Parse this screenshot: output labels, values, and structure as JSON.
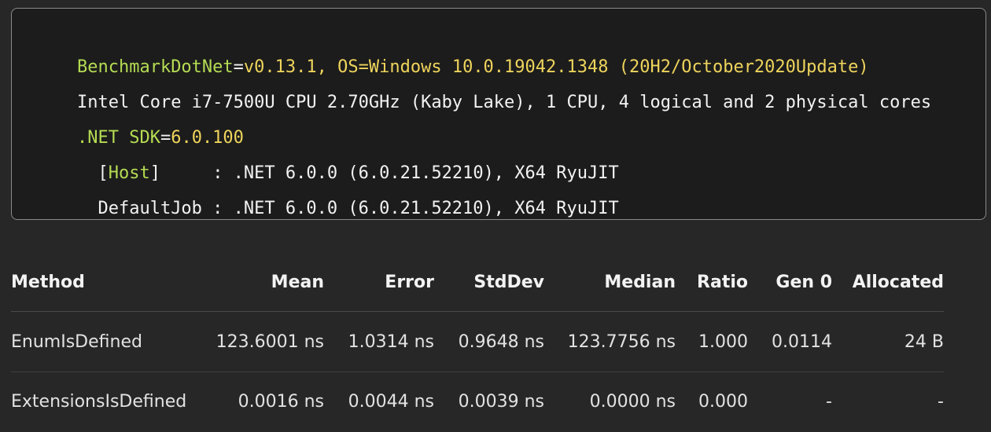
{
  "code_block": {
    "lines": [
      {
        "parts": [
          {
            "text": "BenchmarkDotNet",
            "color": "#b5dc53"
          },
          {
            "text": "=",
            "color": "#f2f2f2"
          },
          {
            "text": "v0.13.1, OS=Windows 10.0.19042.1348 (20H2/October2020Update)",
            "color": "#eed45c"
          }
        ]
      },
      {
        "parts": [
          {
            "text": "Intel Core i7-7500U CPU 2.70GHz (Kaby Lake), 1 CPU, 4 logical and 2 physical cores",
            "color": "#f2f2f2"
          }
        ]
      },
      {
        "parts": [
          {
            "text": ".NET SDK",
            "color": "#b5dc53"
          },
          {
            "text": "=",
            "color": "#f2f2f2"
          },
          {
            "text": "6.0.100",
            "color": "#eed45c"
          }
        ]
      },
      {
        "parts": [
          {
            "text": "  [",
            "color": "#f2f2f2"
          },
          {
            "text": "Host",
            "color": "#b5dc53"
          },
          {
            "text": "]     : .NET 6.0.0 (6.0.21.52210), X64 RyuJIT",
            "color": "#f2f2f2"
          }
        ]
      },
      {
        "parts": [
          {
            "text": "  DefaultJob : .NET 6.0.0 (6.0.21.52210), X64 RyuJIT",
            "color": "#f2f2f2"
          }
        ]
      }
    ]
  },
  "results_table": {
    "headers": {
      "method": "Method",
      "mean": "Mean",
      "error": "Error",
      "stddev": "StdDev",
      "median": "Median",
      "ratio": "Ratio",
      "gen0": "Gen 0",
      "allocated": "Allocated"
    },
    "rows": [
      {
        "method": "EnumIsDefined",
        "mean": "123.6001 ns",
        "error": "1.0314 ns",
        "stddev": "0.9648 ns",
        "median": "123.7756 ns",
        "ratio": "1.000",
        "gen0": "0.0114",
        "allocated": "24 B"
      },
      {
        "method": "ExtensionsIsDefined",
        "mean": "0.0016 ns",
        "error": "0.0044 ns",
        "stddev": "0.0039 ns",
        "median": "0.0000 ns",
        "ratio": "0.000",
        "gen0": "-",
        "allocated": "-"
      }
    ]
  }
}
